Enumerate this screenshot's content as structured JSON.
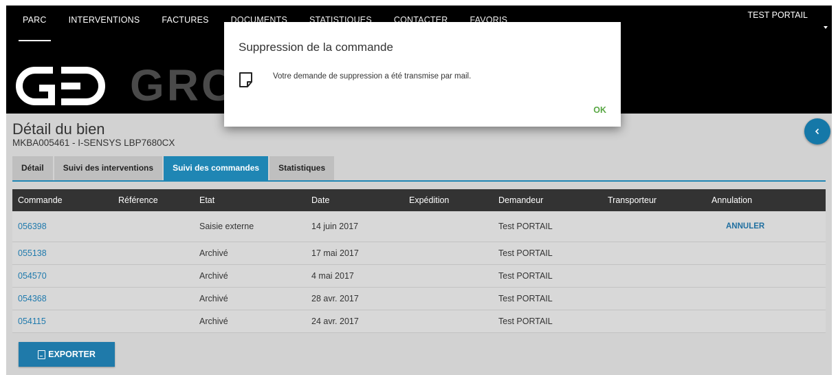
{
  "header": {
    "nav": [
      "PARC",
      "INTERVENTIONS",
      "FACTURES",
      "DOCUMENTS",
      "STATISTIQUES",
      "CONTACTER",
      "FAVORIS"
    ],
    "active_nav": "PARC",
    "user": "TEST PORTAIL",
    "logo_text": "GRO"
  },
  "page": {
    "title": "Détail du bien",
    "subtitle": "MKBA005461 - I-SENSYS LBP7680CX",
    "back_icon": "chevron-left-icon"
  },
  "tabs": [
    {
      "label": "Détail",
      "active": false
    },
    {
      "label": "Suivi des interventions",
      "active": false
    },
    {
      "label": "Suivi des commandes",
      "active": true
    },
    {
      "label": "Statistiques",
      "active": false
    }
  ],
  "table": {
    "columns": [
      "Commande",
      "Référence",
      "Etat",
      "Date",
      "Expédition",
      "Demandeur",
      "Transporteur",
      "Annulation"
    ],
    "rows": [
      {
        "commande": "056398",
        "reference": "",
        "etat": "Saisie externe",
        "date": "14 juin 2017",
        "expedition": "",
        "demandeur": "Test PORTAIL",
        "transporteur": "",
        "annulation": "ANNULER"
      },
      {
        "commande": "055138",
        "reference": "",
        "etat": "Archivé",
        "date": "17 mai 2017",
        "expedition": "",
        "demandeur": "Test PORTAIL",
        "transporteur": "",
        "annulation": ""
      },
      {
        "commande": "054570",
        "reference": "",
        "etat": "Archivé",
        "date": "4 mai 2017",
        "expedition": "",
        "demandeur": "Test PORTAIL",
        "transporteur": "",
        "annulation": ""
      },
      {
        "commande": "054368",
        "reference": "",
        "etat": "Archivé",
        "date": "28 avr. 2017",
        "expedition": "",
        "demandeur": "Test PORTAIL",
        "transporteur": "",
        "annulation": ""
      },
      {
        "commande": "054115",
        "reference": "",
        "etat": "Archivé",
        "date": "24 avr. 2017",
        "expedition": "",
        "demandeur": "Test PORTAIL",
        "transporteur": "",
        "annulation": ""
      }
    ]
  },
  "export_label": "EXPORTER",
  "dialog": {
    "title": "Suppression de la commande",
    "message": "Votre demande de suppression a été transmise par mail.",
    "ok_label": "OK",
    "icon": "note-icon"
  },
  "colors": {
    "accent": "#1f86b4",
    "ok": "#5aa845",
    "header_bg": "#000000",
    "table_header_bg": "#333333"
  }
}
